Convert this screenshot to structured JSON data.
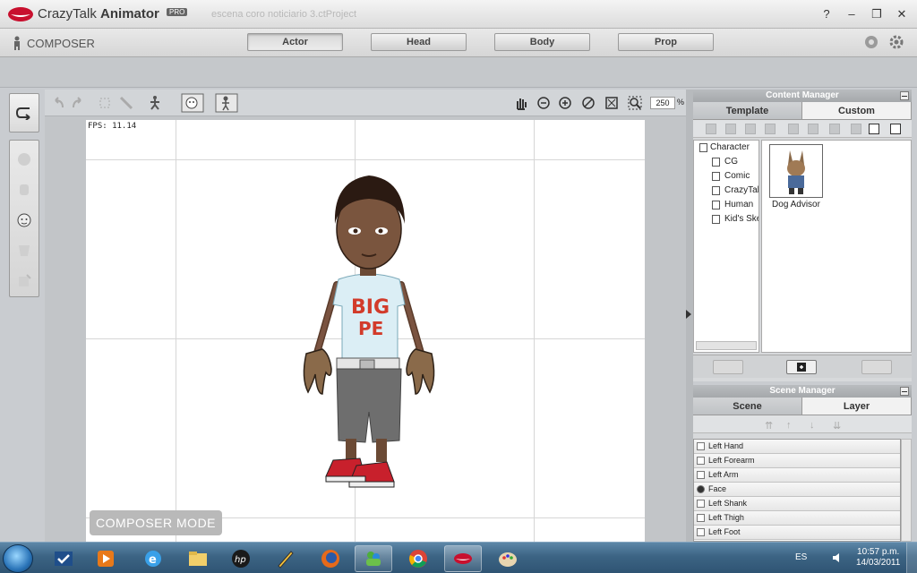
{
  "app": {
    "name_prefix": "CrazyTalk",
    "name_main": "Animator",
    "badge": "PRO",
    "project_title": "escena coro noticiario 3.ctProject",
    "window_buttons": [
      "?",
      "–",
      "❐",
      "✕"
    ]
  },
  "modebar": {
    "composer_label": "COMPOSER",
    "tabs": [
      {
        "label": "Actor",
        "active": true
      },
      {
        "label": "Head",
        "active": false
      },
      {
        "label": "Body",
        "active": false
      },
      {
        "label": "Prop",
        "active": false
      }
    ]
  },
  "viewport": {
    "zoom": "250",
    "zoom_unit": "%",
    "fps": "FPS: 11.14",
    "mode_label": "COMPOSER MODE"
  },
  "content_manager": {
    "title": "Content Manager",
    "tabs": [
      {
        "label": "Template",
        "active": false
      },
      {
        "label": "Custom",
        "active": true
      }
    ],
    "tree": [
      {
        "label": "Character",
        "level": 0
      },
      {
        "label": "CG",
        "level": 1
      },
      {
        "label": "Comic",
        "level": 1
      },
      {
        "label": "CrazyTalk",
        "level": 1
      },
      {
        "label": "Human",
        "level": 1
      },
      {
        "label": "Kid's Sket",
        "level": 1
      }
    ],
    "items": [
      {
        "label": "Dog Advisor"
      }
    ]
  },
  "scene_manager": {
    "title": "Scene Manager",
    "tabs": [
      {
        "label": "Scene",
        "active": false
      },
      {
        "label": "Layer",
        "active": true
      }
    ],
    "layers": [
      "Left Hand",
      "Left Forearm",
      "Left Arm",
      "Face",
      "Left Shank",
      "Left Thigh",
      "Left Foot"
    ]
  },
  "taskbar": {
    "language": "ES",
    "time": "10:57 p.m.",
    "date": "14/03/2011",
    "apps": [
      {
        "name": "task-manager-icon",
        "running": false
      },
      {
        "name": "media-player-icon",
        "running": false
      },
      {
        "name": "internet-explorer-icon",
        "running": false
      },
      {
        "name": "file-explorer-icon",
        "running": false
      },
      {
        "name": "hp-icon",
        "running": false
      },
      {
        "name": "pen-tool-icon",
        "running": false
      },
      {
        "name": "firefox-icon",
        "running": false
      },
      {
        "name": "messenger-icon",
        "running": true
      },
      {
        "name": "chrome-icon",
        "running": false
      },
      {
        "name": "crazytalk-icon",
        "running": true
      },
      {
        "name": "paint-icon",
        "running": false
      }
    ]
  },
  "colors": {
    "accent_red": "#c8102e",
    "taskbar_blue": "#3c6484",
    "panel_gray": "#d7d9db"
  }
}
